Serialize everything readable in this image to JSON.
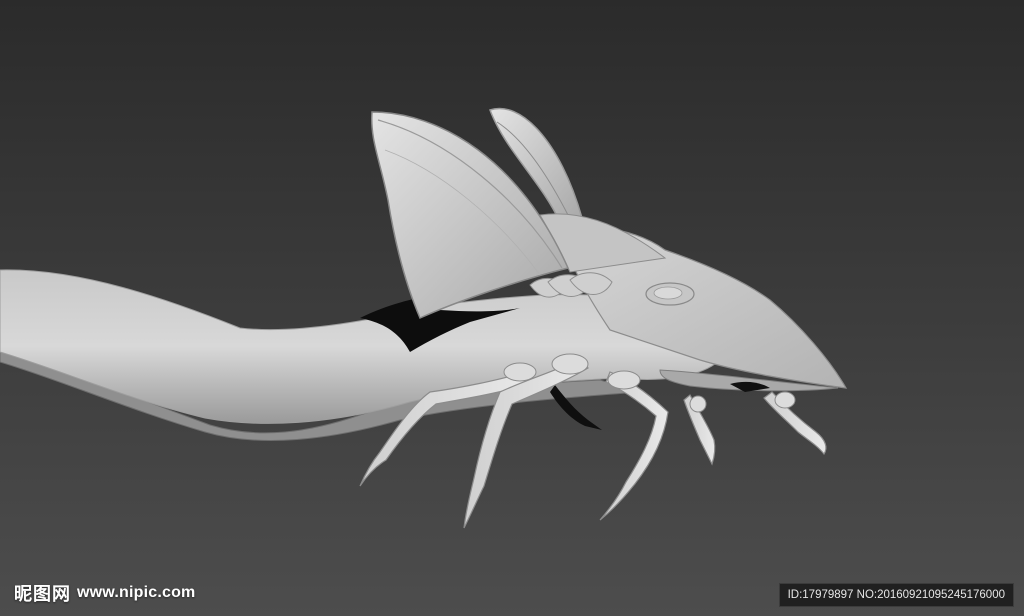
{
  "watermark": {
    "logo_cn": "昵图网",
    "logo_url": "www.nipic.com",
    "id_text": "ID:17979897 NO:20160921095245176000"
  },
  "colors": {
    "background_top": "#2b2b2b",
    "background_bottom": "#4d4d4d",
    "model_light": "#d9d9d9",
    "model_mid": "#bdbdbd",
    "model_shadow": "#8a8a8a"
  }
}
